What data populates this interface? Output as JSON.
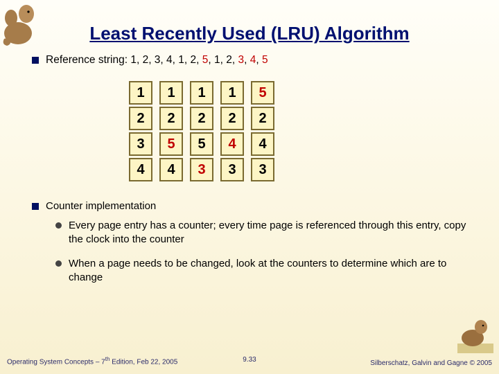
{
  "title": "Least Recently Used (LRU) Algorithm",
  "bullet1_prefix": "Reference string:  1, 2, 3, 4, 1, 2, ",
  "bullet1_r1": "5",
  "bullet1_mid": ", 1, 2, ",
  "bullet1_r2": "3",
  "bullet1_mid2": ", ",
  "bullet1_r3": "4",
  "bullet1_mid3": ", ",
  "bullet1_r4": "5",
  "frames": [
    [
      [
        "1",
        false
      ],
      [
        "1",
        false
      ],
      [
        "1",
        false
      ],
      [
        "1",
        false
      ],
      [
        "5",
        true
      ]
    ],
    [
      [
        "2",
        false
      ],
      [
        "2",
        false
      ],
      [
        "2",
        false
      ],
      [
        "2",
        false
      ],
      [
        "2",
        false
      ]
    ],
    [
      [
        "3",
        false
      ],
      [
        "5",
        true
      ],
      [
        "5",
        false
      ],
      [
        "4",
        true
      ],
      [
        "4",
        false
      ]
    ],
    [
      [
        "4",
        false
      ],
      [
        "4",
        false
      ],
      [
        "3",
        true
      ],
      [
        "3",
        false
      ],
      [
        "3",
        false
      ]
    ]
  ],
  "bullet2": "Counter implementation",
  "sub1": "Every page entry has a counter; every time page is referenced through this entry, copy the clock into the counter",
  "sub2": "When a page needs to be changed, look at the counters to determine which are to change",
  "footer_left_a": "Operating System Concepts – 7",
  "footer_left_sup": "th",
  "footer_left_b": " Edition, Feb 22, 2005",
  "footer_center": "9.33",
  "footer_right": "Silberschatz, Galvin and Gagne © 2005"
}
